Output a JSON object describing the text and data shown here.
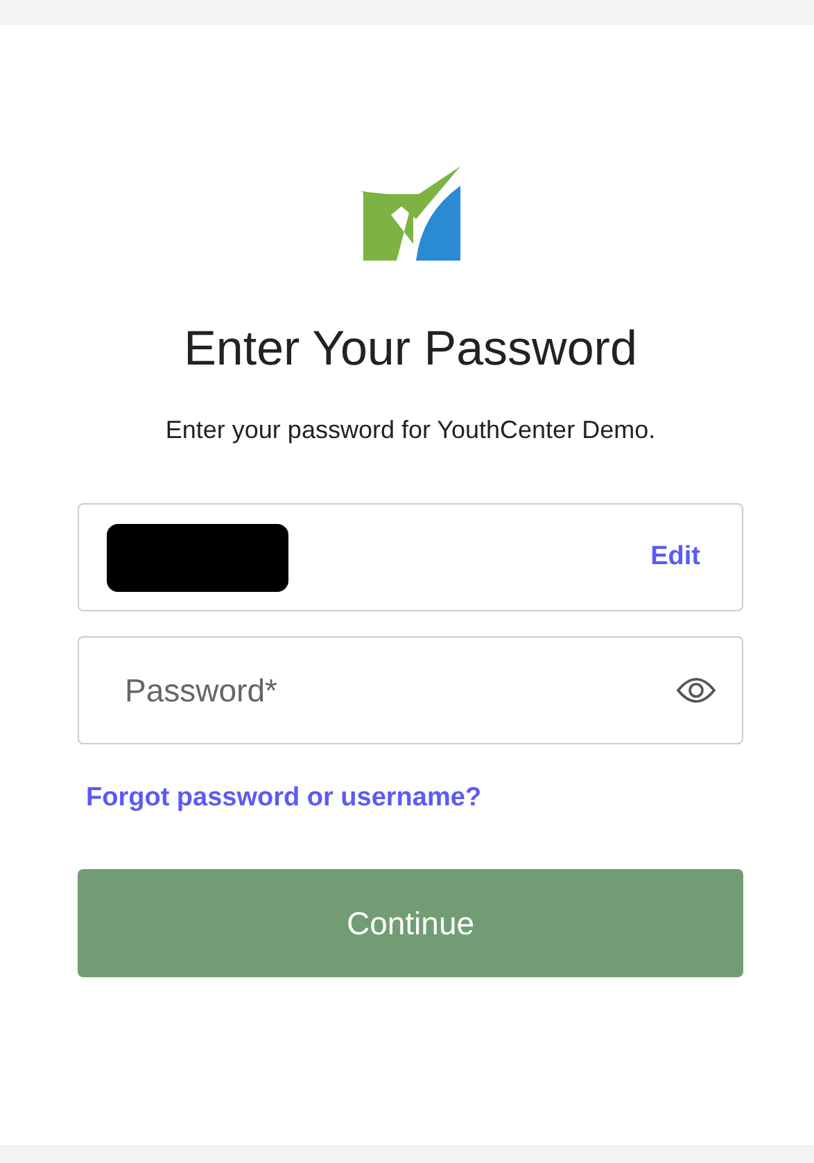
{
  "heading": "Enter Your Password",
  "subtitle": "Enter your password for YouthCenter Demo.",
  "username_field": {
    "edit_link": "Edit"
  },
  "password_field": {
    "placeholder": "Password*"
  },
  "forgot_link": "Forgot password or username?",
  "continue_button": "Continue"
}
